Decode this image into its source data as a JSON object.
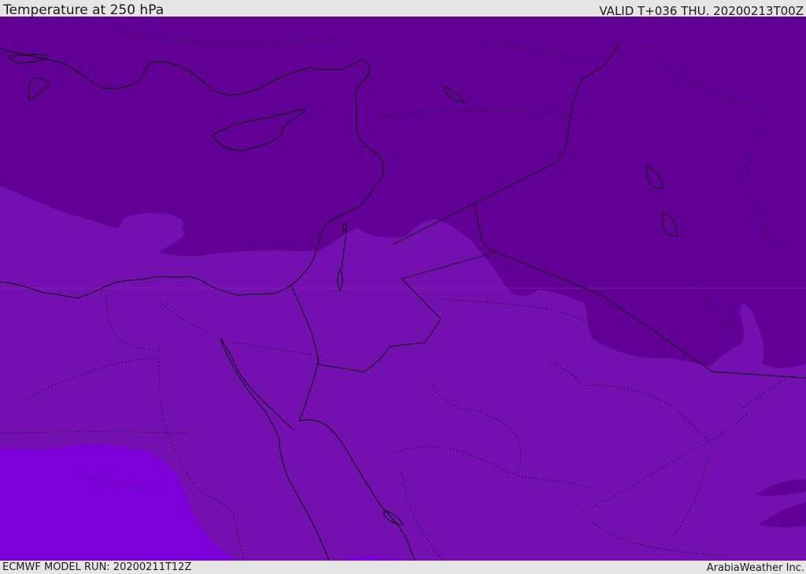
{
  "header": {
    "title": "Temperature at 250 hPa",
    "valid": "VALID T+036 THU. 20200213T00Z"
  },
  "footer": {
    "model_run": "ECMWF MODEL RUN: 20200211T12Z",
    "credit": "ArabiaWeather Inc."
  },
  "map": {
    "colors": {
      "cold_band": "#620096",
      "mid_band": "#7410b0",
      "warm_band": "#7e00d8",
      "coastline": "#000000",
      "border_dotted": "#000000"
    }
  }
}
